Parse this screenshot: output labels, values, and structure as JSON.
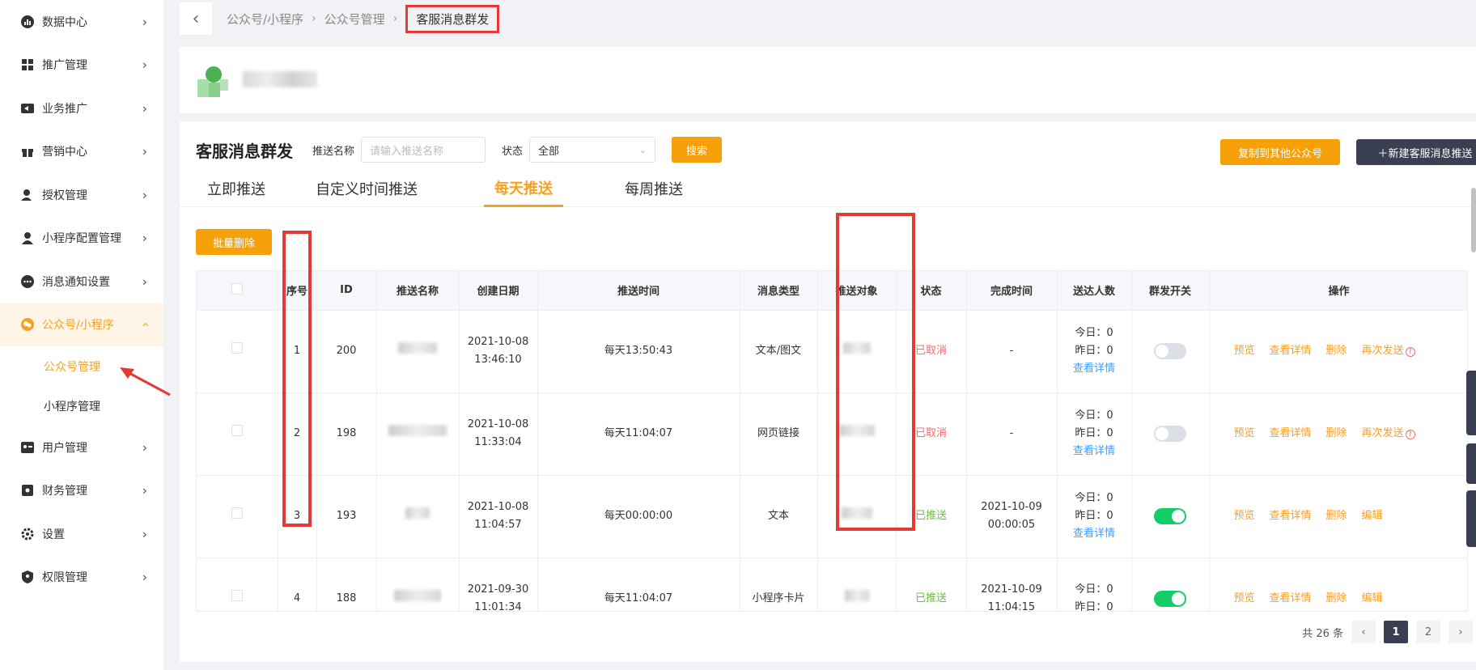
{
  "sidebar": {
    "items": [
      {
        "label": "数据中心",
        "icon": "chart-icon"
      },
      {
        "label": "推广管理",
        "icon": "grid-icon"
      },
      {
        "label": "业务推广",
        "icon": "megaphone-icon"
      },
      {
        "label": "营销中心",
        "icon": "gift-icon"
      },
      {
        "label": "授权管理",
        "icon": "user-check-icon"
      },
      {
        "label": "小程序配置管理",
        "icon": "user-icon"
      },
      {
        "label": "消息通知设置",
        "icon": "chat-icon"
      },
      {
        "label": "公众号/小程序",
        "icon": "wechat-icon"
      },
      {
        "label": "用户管理",
        "icon": "id-card-icon"
      },
      {
        "label": "财务管理",
        "icon": "wallet-icon"
      },
      {
        "label": "设置",
        "icon": "gear-icon"
      },
      {
        "label": "权限管理",
        "icon": "shield-icon"
      }
    ],
    "sub_items": [
      {
        "label": "公众号管理"
      },
      {
        "label": "小程序管理"
      }
    ]
  },
  "breadcrumb": {
    "items": [
      "公众号/小程序",
      "公众号管理",
      "客服消息群发"
    ]
  },
  "toolbar": {
    "title": "客服消息群发",
    "name_label": "推送名称",
    "name_placeholder": "请输入推送名称",
    "status_label": "状态",
    "status_value": "全部",
    "search_label": "搜索",
    "copy_label": "复制到其他公众号",
    "new_label": "＋新建客服消息推送"
  },
  "tabs": [
    "立即推送",
    "自定义时间推送",
    "每天推送",
    "每周推送"
  ],
  "active_tab": "每天推送",
  "batch_delete_label": "批量删除",
  "table": {
    "headers": [
      "序号",
      "ID",
      "推送名称",
      "创建日期",
      "推送时间",
      "消息类型",
      "推送对象",
      "状态",
      "完成时间",
      "送达人数",
      "群发开关",
      "操作"
    ],
    "rows": [
      {
        "index": "1",
        "id": "200",
        "created_date": "2021-10-08",
        "created_time": "13:46:10",
        "push_time": "每天13:50:43",
        "msg_type": "文本/图文",
        "status": "已取消",
        "status_kind": "cancel",
        "finish_date": "-",
        "finish_time": "",
        "today": "今日：0",
        "yesterday": "昨日：0",
        "detail_link": "查看详情",
        "switch_on": false,
        "ops": [
          "预览",
          "查看详情",
          "删除",
          "再次发送"
        ]
      },
      {
        "index": "2",
        "id": "198",
        "created_date": "2021-10-08",
        "created_time": "11:33:04",
        "push_time": "每天11:04:07",
        "msg_type": "网页链接",
        "status": "已取消",
        "status_kind": "cancel",
        "finish_date": "-",
        "finish_time": "",
        "today": "今日：0",
        "yesterday": "昨日：0",
        "detail_link": "查看详情",
        "switch_on": false,
        "ops": [
          "预览",
          "查看详情",
          "删除",
          "再次发送"
        ]
      },
      {
        "index": "3",
        "id": "193",
        "created_date": "2021-10-08",
        "created_time": "11:04:57",
        "push_time": "每天00:00:00",
        "msg_type": "文本",
        "status": "已推送",
        "status_kind": "done",
        "finish_date": "2021-10-09",
        "finish_time": "00:00:05",
        "today": "今日：0",
        "yesterday": "昨日：0",
        "detail_link": "查看详情",
        "switch_on": true,
        "ops": [
          "预览",
          "查看详情",
          "删除",
          "编辑"
        ]
      },
      {
        "index": "4",
        "id": "188",
        "created_date": "2021-09-30",
        "created_time": "11:01:34",
        "push_time": "每天11:04:07",
        "msg_type": "小程序卡片",
        "status": "已推送",
        "status_kind": "done",
        "finish_date": "2021-10-09",
        "finish_time": "11:04:15",
        "today": "今日：0",
        "yesterday": "昨日：0",
        "detail_link": "",
        "switch_on": true,
        "ops": [
          "预览",
          "查看详情",
          "删除",
          "编辑"
        ]
      }
    ]
  },
  "pagination": {
    "total": "共 26 条",
    "pages": [
      "1",
      "2"
    ],
    "current": "1"
  },
  "colors": {
    "accent": "#f7a024",
    "annotation_red": "#e53935",
    "cancel": "#f56c6c",
    "done": "#67c23a",
    "link": "#409eff"
  }
}
